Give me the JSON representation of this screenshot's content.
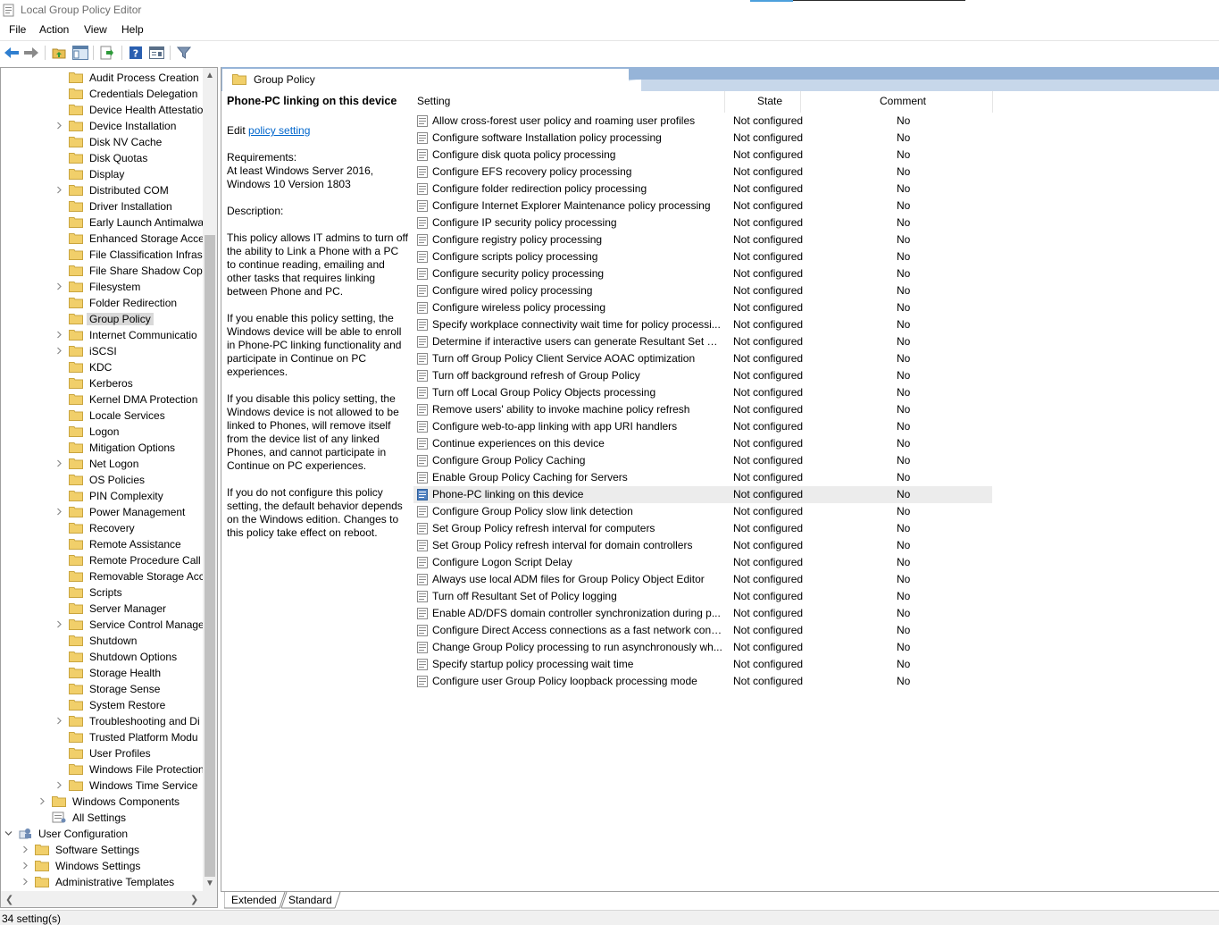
{
  "window": {
    "title": "Local Group Policy Editor"
  },
  "menu": [
    "File",
    "Action",
    "View",
    "Help"
  ],
  "toolbar": [
    "back-icon",
    "forward-icon",
    "up-folder-icon",
    "show-hide-tree-icon",
    "export-list-icon",
    "help-icon",
    "properties-icon",
    "filter-icon"
  ],
  "tree": [
    {
      "label": "Audit Process Creation",
      "level": 3,
      "expander": false,
      "icon": "folder"
    },
    {
      "label": "Credentials Delegation",
      "level": 3,
      "expander": false,
      "icon": "folder"
    },
    {
      "label": "Device Health Attestatio",
      "level": 3,
      "expander": false,
      "icon": "folder"
    },
    {
      "label": "Device Installation",
      "level": 3,
      "expander": true,
      "icon": "folder"
    },
    {
      "label": "Disk NV Cache",
      "level": 3,
      "expander": false,
      "icon": "folder"
    },
    {
      "label": "Disk Quotas",
      "level": 3,
      "expander": false,
      "icon": "folder"
    },
    {
      "label": "Display",
      "level": 3,
      "expander": false,
      "icon": "folder"
    },
    {
      "label": "Distributed COM",
      "level": 3,
      "expander": true,
      "icon": "folder"
    },
    {
      "label": "Driver Installation",
      "level": 3,
      "expander": false,
      "icon": "folder"
    },
    {
      "label": "Early Launch Antimalwa",
      "level": 3,
      "expander": false,
      "icon": "folder"
    },
    {
      "label": "Enhanced Storage Acce",
      "level": 3,
      "expander": false,
      "icon": "folder"
    },
    {
      "label": "File Classification Infras",
      "level": 3,
      "expander": false,
      "icon": "folder"
    },
    {
      "label": "File Share Shadow Copy",
      "level": 3,
      "expander": false,
      "icon": "folder"
    },
    {
      "label": "Filesystem",
      "level": 3,
      "expander": true,
      "icon": "folder"
    },
    {
      "label": "Folder Redirection",
      "level": 3,
      "expander": false,
      "icon": "folder"
    },
    {
      "label": "Group Policy",
      "level": 3,
      "expander": false,
      "icon": "folder",
      "selected": true
    },
    {
      "label": "Internet Communicatio",
      "level": 3,
      "expander": true,
      "icon": "folder"
    },
    {
      "label": "iSCSI",
      "level": 3,
      "expander": true,
      "icon": "folder"
    },
    {
      "label": "KDC",
      "level": 3,
      "expander": false,
      "icon": "folder"
    },
    {
      "label": "Kerberos",
      "level": 3,
      "expander": false,
      "icon": "folder"
    },
    {
      "label": "Kernel DMA Protection",
      "level": 3,
      "expander": false,
      "icon": "folder"
    },
    {
      "label": "Locale Services",
      "level": 3,
      "expander": false,
      "icon": "folder"
    },
    {
      "label": "Logon",
      "level": 3,
      "expander": false,
      "icon": "folder"
    },
    {
      "label": "Mitigation Options",
      "level": 3,
      "expander": false,
      "icon": "folder"
    },
    {
      "label": "Net Logon",
      "level": 3,
      "expander": true,
      "icon": "folder"
    },
    {
      "label": "OS Policies",
      "level": 3,
      "expander": false,
      "icon": "folder"
    },
    {
      "label": "PIN Complexity",
      "level": 3,
      "expander": false,
      "icon": "folder"
    },
    {
      "label": "Power Management",
      "level": 3,
      "expander": true,
      "icon": "folder"
    },
    {
      "label": "Recovery",
      "level": 3,
      "expander": false,
      "icon": "folder"
    },
    {
      "label": "Remote Assistance",
      "level": 3,
      "expander": false,
      "icon": "folder"
    },
    {
      "label": "Remote Procedure Call",
      "level": 3,
      "expander": false,
      "icon": "folder"
    },
    {
      "label": "Removable Storage Acc",
      "level": 3,
      "expander": false,
      "icon": "folder"
    },
    {
      "label": "Scripts",
      "level": 3,
      "expander": false,
      "icon": "folder"
    },
    {
      "label": "Server Manager",
      "level": 3,
      "expander": false,
      "icon": "folder"
    },
    {
      "label": "Service Control Manage",
      "level": 3,
      "expander": true,
      "icon": "folder"
    },
    {
      "label": "Shutdown",
      "level": 3,
      "expander": false,
      "icon": "folder"
    },
    {
      "label": "Shutdown Options",
      "level": 3,
      "expander": false,
      "icon": "folder"
    },
    {
      "label": "Storage Health",
      "level": 3,
      "expander": false,
      "icon": "folder"
    },
    {
      "label": "Storage Sense",
      "level": 3,
      "expander": false,
      "icon": "folder"
    },
    {
      "label": "System Restore",
      "level": 3,
      "expander": false,
      "icon": "folder"
    },
    {
      "label": "Troubleshooting and Di",
      "level": 3,
      "expander": true,
      "icon": "folder"
    },
    {
      "label": "Trusted Platform Modu",
      "level": 3,
      "expander": false,
      "icon": "folder"
    },
    {
      "label": "User Profiles",
      "level": 3,
      "expander": false,
      "icon": "folder"
    },
    {
      "label": "Windows File Protection",
      "level": 3,
      "expander": false,
      "icon": "folder"
    },
    {
      "label": "Windows Time Service",
      "level": 3,
      "expander": true,
      "icon": "folder"
    },
    {
      "label": "Windows Components",
      "level": 2,
      "expander": true,
      "icon": "folder"
    },
    {
      "label": "All Settings",
      "level": 2,
      "expander": false,
      "icon": "settings"
    },
    {
      "label": "User Configuration",
      "level": 0,
      "expander": "open",
      "icon": "user"
    },
    {
      "label": "Software Settings",
      "level": 1,
      "expander": true,
      "icon": "folder"
    },
    {
      "label": "Windows Settings",
      "level": 1,
      "expander": true,
      "icon": "folder"
    },
    {
      "label": "Administrative Templates",
      "level": 1,
      "expander": true,
      "icon": "folder"
    }
  ],
  "header": {
    "title": "Group Policy"
  },
  "description": {
    "title": "Phone-PC linking on this device",
    "edit_prefix": "Edit ",
    "edit_link": "policy setting",
    "requirements_label": "Requirements:",
    "requirements": "At least Windows Server 2016, Windows 10 Version 1803",
    "description_label": "Description:",
    "paragraphs": [
      "This policy allows IT admins to turn off the ability to Link a Phone with a PC to continue reading, emailing and other tasks that requires linking between Phone and PC.",
      "If you enable this policy setting, the Windows device will be able to enroll in Phone-PC linking functionality and participate in Continue on PC experiences.",
      "If you disable this policy setting, the Windows device is not allowed to be linked to Phones, will remove itself from the device list of any linked Phones, and cannot participate in Continue on PC experiences.",
      "If you do not configure this policy setting, the default behavior depends on the Windows edition. Changes to this policy take effect on reboot."
    ]
  },
  "columns": {
    "setting": "Setting",
    "state": "State",
    "comment": "Comment"
  },
  "rows": [
    {
      "setting": "Allow cross-forest user policy and roaming user profiles",
      "state": "Not configured",
      "comment": "No"
    },
    {
      "setting": "Configure software Installation policy processing",
      "state": "Not configured",
      "comment": "No"
    },
    {
      "setting": "Configure disk quota policy processing",
      "state": "Not configured",
      "comment": "No"
    },
    {
      "setting": "Configure EFS recovery policy processing",
      "state": "Not configured",
      "comment": "No"
    },
    {
      "setting": "Configure folder redirection policy processing",
      "state": "Not configured",
      "comment": "No"
    },
    {
      "setting": "Configure Internet Explorer Maintenance policy processing",
      "state": "Not configured",
      "comment": "No"
    },
    {
      "setting": "Configure IP security policy processing",
      "state": "Not configured",
      "comment": "No"
    },
    {
      "setting": "Configure registry policy processing",
      "state": "Not configured",
      "comment": "No"
    },
    {
      "setting": "Configure scripts policy processing",
      "state": "Not configured",
      "comment": "No"
    },
    {
      "setting": "Configure security policy processing",
      "state": "Not configured",
      "comment": "No"
    },
    {
      "setting": "Configure wired policy processing",
      "state": "Not configured",
      "comment": "No"
    },
    {
      "setting": "Configure wireless policy processing",
      "state": "Not configured",
      "comment": "No"
    },
    {
      "setting": "Specify workplace connectivity wait time for policy processi...",
      "state": "Not configured",
      "comment": "No"
    },
    {
      "setting": "Determine if interactive users can generate Resultant Set of ...",
      "state": "Not configured",
      "comment": "No"
    },
    {
      "setting": "Turn off Group Policy Client Service AOAC optimization",
      "state": "Not configured",
      "comment": "No"
    },
    {
      "setting": "Turn off background refresh of Group Policy",
      "state": "Not configured",
      "comment": "No"
    },
    {
      "setting": "Turn off Local Group Policy Objects processing",
      "state": "Not configured",
      "comment": "No"
    },
    {
      "setting": "Remove users' ability to invoke machine policy refresh",
      "state": "Not configured",
      "comment": "No"
    },
    {
      "setting": "Configure web-to-app linking with app URI handlers",
      "state": "Not configured",
      "comment": "No"
    },
    {
      "setting": "Continue experiences on this device",
      "state": "Not configured",
      "comment": "No"
    },
    {
      "setting": "Configure Group Policy Caching",
      "state": "Not configured",
      "comment": "No"
    },
    {
      "setting": "Enable Group Policy Caching for Servers",
      "state": "Not configured",
      "comment": "No"
    },
    {
      "setting": "Phone-PC linking on this device",
      "state": "Not configured",
      "comment": "No",
      "selected": true
    },
    {
      "setting": "Configure Group Policy slow link detection",
      "state": "Not configured",
      "comment": "No"
    },
    {
      "setting": "Set Group Policy refresh interval for computers",
      "state": "Not configured",
      "comment": "No"
    },
    {
      "setting": "Set Group Policy refresh interval for domain controllers",
      "state": "Not configured",
      "comment": "No"
    },
    {
      "setting": "Configure Logon Script Delay",
      "state": "Not configured",
      "comment": "No"
    },
    {
      "setting": "Always use local ADM files for Group Policy Object Editor",
      "state": "Not configured",
      "comment": "No"
    },
    {
      "setting": "Turn off Resultant Set of Policy logging",
      "state": "Not configured",
      "comment": "No"
    },
    {
      "setting": "Enable AD/DFS domain controller synchronization during p...",
      "state": "Not configured",
      "comment": "No"
    },
    {
      "setting": "Configure Direct Access connections as a fast network conn...",
      "state": "Not configured",
      "comment": "No"
    },
    {
      "setting": "Change Group Policy processing to run asynchronously wh...",
      "state": "Not configured",
      "comment": "No"
    },
    {
      "setting": "Specify startup policy processing wait time",
      "state": "Not configured",
      "comment": "No"
    },
    {
      "setting": "Configure user Group Policy loopback processing mode",
      "state": "Not configured",
      "comment": "No"
    }
  ],
  "tabs": [
    "Extended",
    "Standard"
  ],
  "status": "34 setting(s)"
}
